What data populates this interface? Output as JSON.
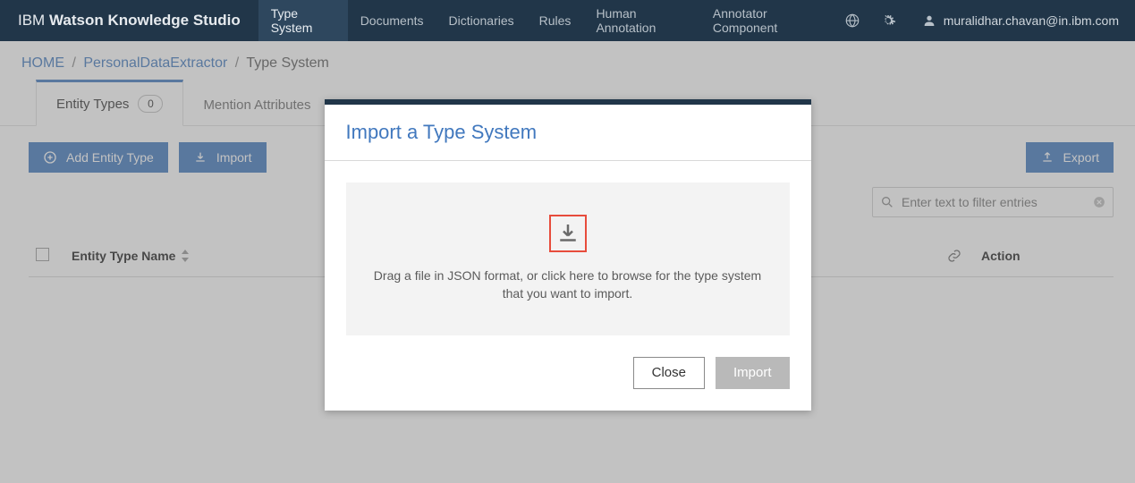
{
  "brand": {
    "prefix": "IBM",
    "bold": "Watson Knowledge Studio"
  },
  "nav": {
    "type_system": "Type System",
    "documents": "Documents",
    "dictionaries": "Dictionaries",
    "rules": "Rules",
    "human_annotation": "Human Annotation",
    "annotator_component": "Annotator Component"
  },
  "user": {
    "email": "muralidhar.chavan@in.ibm.com"
  },
  "breadcrumbs": {
    "home": "HOME",
    "project": "PersonalDataExtractor",
    "current": "Type System"
  },
  "subtabs": {
    "entity_types": {
      "label": "Entity Types",
      "count": "0"
    },
    "mention_attributes": {
      "label": "Mention Attributes"
    }
  },
  "buttons": {
    "add_entity_type": "Add Entity Type",
    "import": "Import",
    "export": "Export"
  },
  "filter": {
    "placeholder": "Enter text to filter entries"
  },
  "table": {
    "col_name": "Entity Type Name",
    "col_action": "Action",
    "rows": []
  },
  "modal": {
    "title": "Import a Type System",
    "drop_message": "Drag a file in JSON format, or click here to browse for the type system that you want to import.",
    "close": "Close",
    "import": "Import"
  }
}
